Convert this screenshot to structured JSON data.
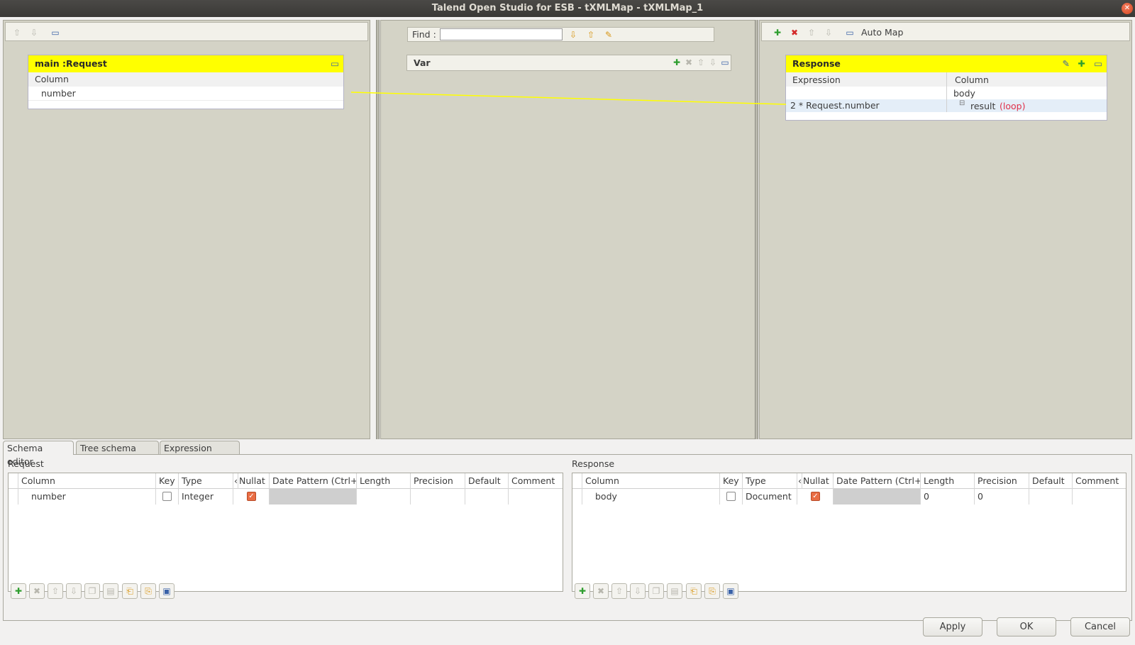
{
  "window": {
    "title": "Talend Open Studio for ESB - tXMLMap - tXMLMap_1"
  },
  "colors": {
    "table_header": "#ffff00",
    "link_line": "#ffff00",
    "loop_label": "#e0304a",
    "zone_bg": "#d4d3c6"
  },
  "input_zone": {
    "icons": [
      "arrow-up-icon",
      "arrow-down-icon",
      "minimize-icon"
    ],
    "table": {
      "title": "main :Request",
      "column_header": "Column",
      "rows": [
        "number"
      ]
    }
  },
  "var_zone": {
    "find_label": "Find :",
    "find_value": "",
    "table": {
      "title": "Var"
    }
  },
  "output_zone": {
    "auto_map_label": "Auto Map",
    "table": {
      "title": "Response",
      "expression_header": "Expression",
      "column_header": "Column",
      "body_label": "body",
      "expression_value": "2 * Request.number",
      "result_label": "result",
      "loop_label": "(loop)"
    }
  },
  "tabs": [
    "Schema editor",
    "Tree schema editor",
    "Expression editor"
  ],
  "schema_editor": {
    "left": {
      "title": "Request",
      "headers": [
        "Column",
        "Key",
        "Type",
        "‹",
        "Nullat",
        "Date Pattern (Ctrl+S",
        "Length",
        "Precision",
        "Default",
        "Comment"
      ],
      "rows": [
        {
          "column": "number",
          "key": false,
          "type": "Integer",
          "nullable": true,
          "length": "",
          "precision": ""
        }
      ]
    },
    "right": {
      "title": "Response",
      "headers": [
        "Column",
        "Key",
        "Type",
        "‹",
        "Nullat",
        "Date Pattern (Ctrl+S",
        "Length",
        "Precision",
        "Default",
        "Comment"
      ],
      "rows": [
        {
          "column": "body",
          "key": false,
          "type": "Document",
          "nullable": true,
          "length": "0",
          "precision": "0"
        }
      ]
    }
  },
  "buttons": {
    "apply": "Apply",
    "ok": "OK",
    "cancel": "Cancel"
  }
}
